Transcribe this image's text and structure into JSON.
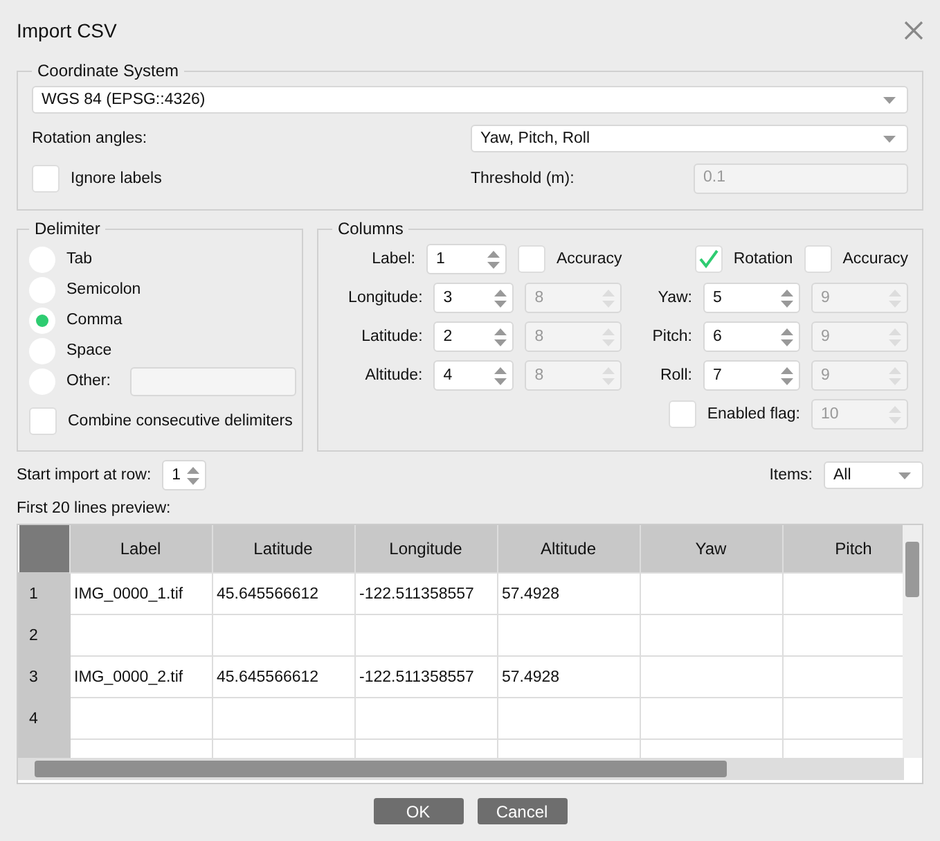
{
  "window": {
    "title": "Import CSV"
  },
  "coordinate_system": {
    "title": "Coordinate System",
    "value": "WGS 84 (EPSG::4326)",
    "rotation_label": "Rotation angles:",
    "rotation_value": "Yaw, Pitch, Roll",
    "ignore_labels": {
      "label": "Ignore labels",
      "checked": false
    },
    "threshold": {
      "label": "Threshold (m):",
      "value": "0.1",
      "disabled": true
    }
  },
  "delimiter": {
    "title": "Delimiter",
    "options": [
      {
        "label": "Tab",
        "selected": false
      },
      {
        "label": "Semicolon",
        "selected": false
      },
      {
        "label": "Comma",
        "selected": true
      },
      {
        "label": "Space",
        "selected": false
      },
      {
        "label": "Other:",
        "selected": false,
        "kind": "field"
      }
    ],
    "combine": {
      "label": "Combine consecutive delimiters",
      "checked": false
    }
  },
  "columns": {
    "title": "Columns",
    "left": [
      {
        "label": "Label:",
        "value": "1",
        "extra": {
          "kind": "checkbox",
          "label": "Accuracy",
          "checked": false
        }
      },
      {
        "label": "Longitude:",
        "value": "3",
        "extra": {
          "kind": "spin",
          "value": "8",
          "disabled": true
        }
      },
      {
        "label": "Latitude:",
        "value": "2",
        "extra": {
          "kind": "spin",
          "value": "8",
          "disabled": true
        }
      },
      {
        "label": "Altitude:",
        "value": "4",
        "extra": {
          "kind": "spin",
          "value": "8",
          "disabled": true
        }
      }
    ],
    "rotation": {
      "label": "Rotation",
      "checked": true
    },
    "rotation_accuracy": {
      "label": "Accuracy",
      "checked": false
    },
    "right": [
      {
        "label": "Yaw:",
        "value": "5",
        "extra_value": "9",
        "disabled": true
      },
      {
        "label": "Pitch:",
        "value": "6",
        "extra_value": "9",
        "disabled": true
      },
      {
        "label": "Roll:",
        "value": "7",
        "extra_value": "9",
        "disabled": true
      }
    ],
    "enabled_flag": {
      "label": "Enabled flag:",
      "checked": false,
      "value": "10",
      "disabled": true
    }
  },
  "start_row": {
    "label": "Start import at row:",
    "value": "1"
  },
  "items": {
    "label": "Items:",
    "value": "All"
  },
  "preview": {
    "label": "First 20 lines preview:",
    "columns": [
      "Label",
      "Latitude",
      "Longitude",
      "Altitude",
      "Yaw",
      "Pitch"
    ],
    "rows": [
      {
        "number": "1",
        "cells": [
          "IMG_0000_1.tif",
          "45.645566612",
          "-122.511358557",
          "57.4928"
        ]
      },
      {
        "number": "2",
        "cells": []
      },
      {
        "number": "3",
        "cells": [
          "IMG_0000_2.tif",
          "45.645566612",
          "-122.511358557",
          "57.4928"
        ]
      },
      {
        "number": "4",
        "cells": []
      }
    ]
  },
  "buttons": [
    "OK",
    "Cancel"
  ]
}
